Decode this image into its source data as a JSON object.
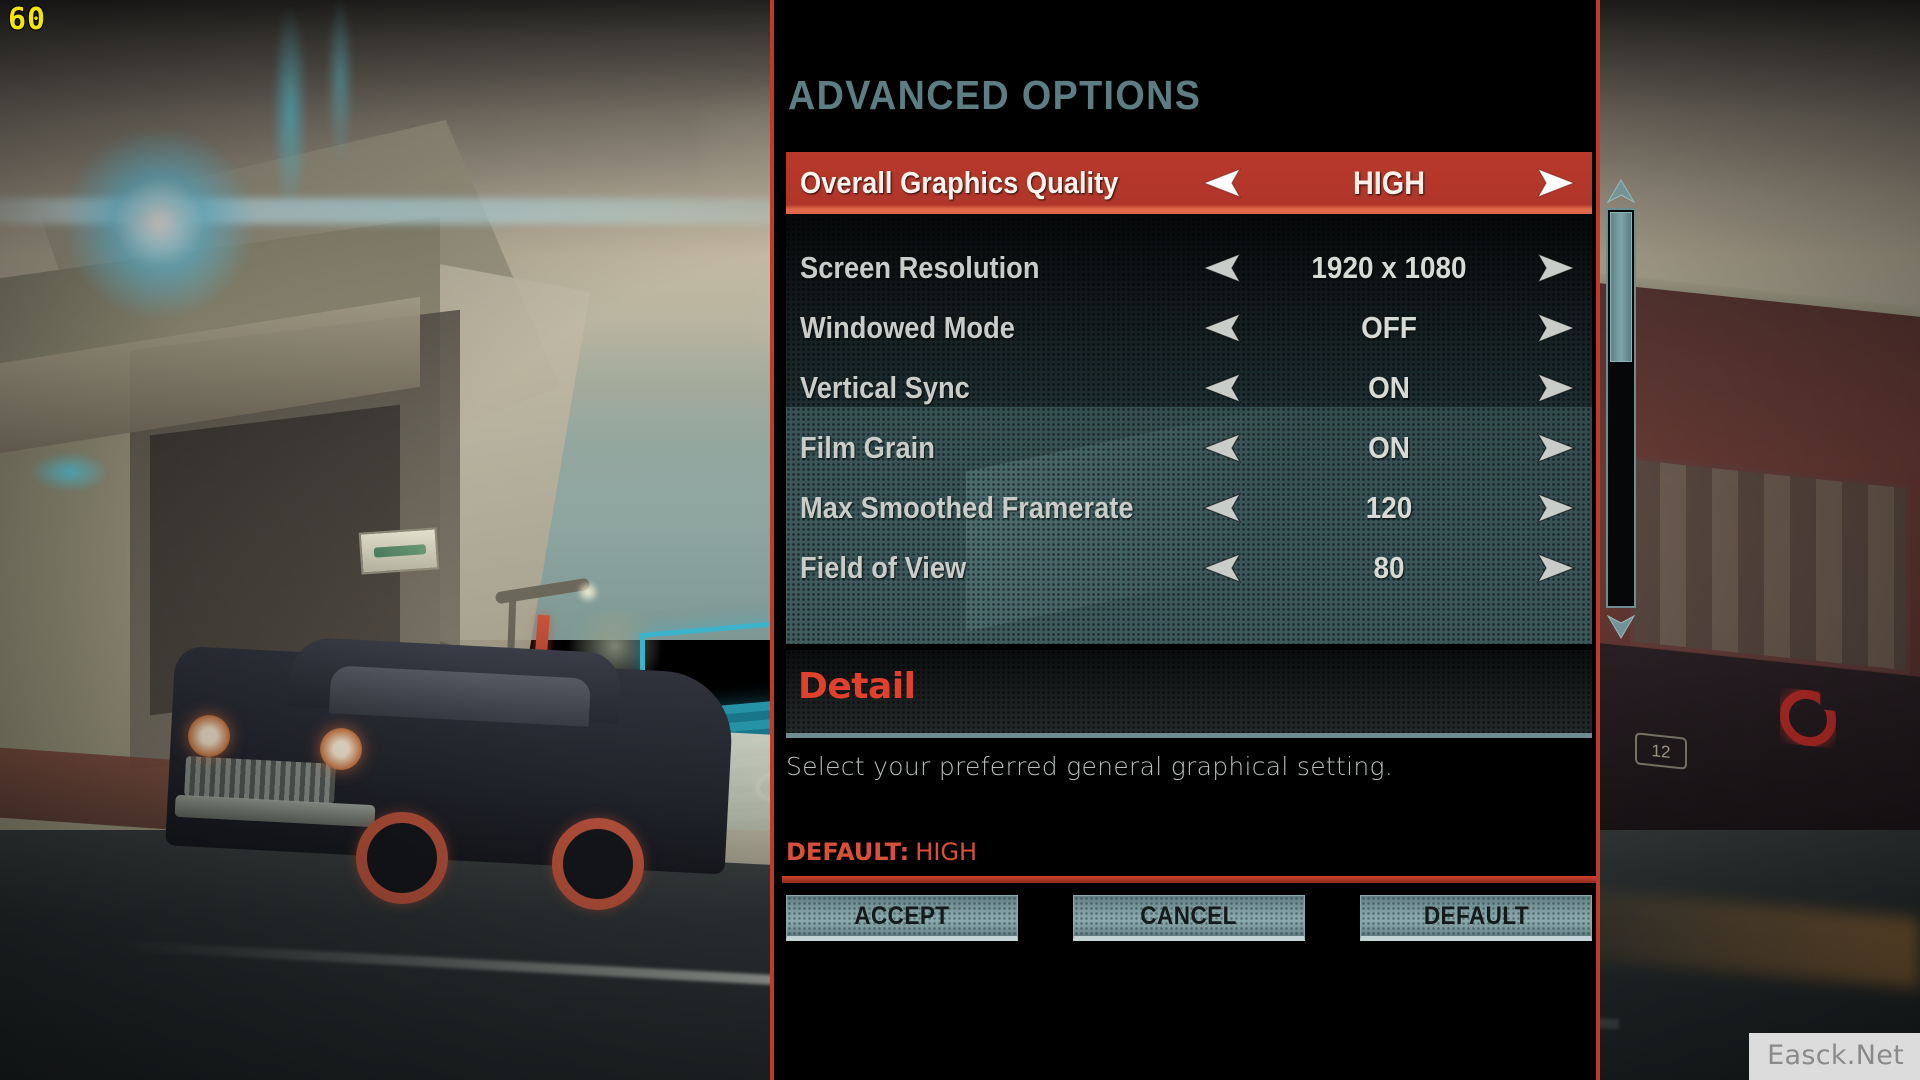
{
  "hud": {
    "fps": "60"
  },
  "menu": {
    "title": "ADVANCED OPTIONS",
    "accent_red": "#b8392a",
    "accent_red_bright": "#e1412c",
    "panel_teal": "#5c7e83",
    "rows": [
      {
        "label": "Overall Graphics Quality",
        "value": "HIGH",
        "selected": true
      },
      {
        "label": "Screen Resolution",
        "value": "1920 x 1080",
        "selected": false
      },
      {
        "label": "Windowed Mode",
        "value": "OFF",
        "selected": false
      },
      {
        "label": "Vertical Sync",
        "value": "ON",
        "selected": false
      },
      {
        "label": "Film Grain",
        "value": "ON",
        "selected": false
      },
      {
        "label": "Max Smoothed Framerate",
        "value": "120",
        "selected": false
      },
      {
        "label": "Field of View",
        "value": "80",
        "selected": false
      }
    ],
    "detail": {
      "heading": "Detail",
      "description": "Select your preferred general graphical setting.",
      "default_key": "DEFAULT:",
      "default_value": "HIGH"
    },
    "buttons": [
      {
        "label": "ACCEPT"
      },
      {
        "label": "CANCEL"
      },
      {
        "label": "DEFAULT"
      }
    ],
    "scrollbar": {
      "up_icon": "chevron-up-icon",
      "down_icon": "chevron-down-icon"
    }
  },
  "watermark": {
    "text": "Easck.Net"
  }
}
